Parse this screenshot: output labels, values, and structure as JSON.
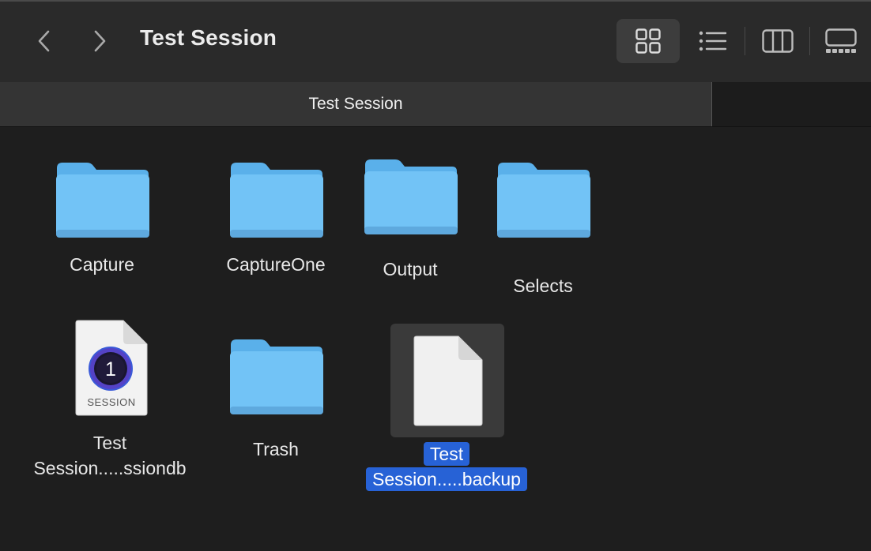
{
  "window": {
    "title": "Test Session"
  },
  "toolbar": {
    "back_icon": "chevron-left-icon",
    "forward_icon": "chevron-right-icon",
    "views": [
      {
        "name": "icon-view",
        "icon": "grid-icon",
        "active": true
      },
      {
        "name": "list-view",
        "icon": "list-icon",
        "active": false
      },
      {
        "name": "column-view",
        "icon": "columns-icon",
        "active": false
      },
      {
        "name": "gallery-view",
        "icon": "gallery-icon",
        "active": false
      }
    ]
  },
  "tabs": [
    {
      "label": "Test Session"
    }
  ],
  "items": [
    {
      "label": "Capture",
      "type": "folder"
    },
    {
      "label": "CaptureOne",
      "type": "folder"
    },
    {
      "label": "Output",
      "type": "folder"
    },
    {
      "label": "Selects",
      "type": "folder"
    },
    {
      "label_line1": "Test",
      "label_line2": "Session.....ssiondb",
      "type": "session-document",
      "badge": "SESSION",
      "logo_text": "1"
    },
    {
      "label": "Trash",
      "type": "folder"
    },
    {
      "label_line1": "Test",
      "label_line2": "Session.....backup",
      "type": "document",
      "selected": true
    }
  ],
  "colors": {
    "folder": "#5ab0ea",
    "folder_front": "#72c3f6",
    "selection": "#2762d6"
  }
}
